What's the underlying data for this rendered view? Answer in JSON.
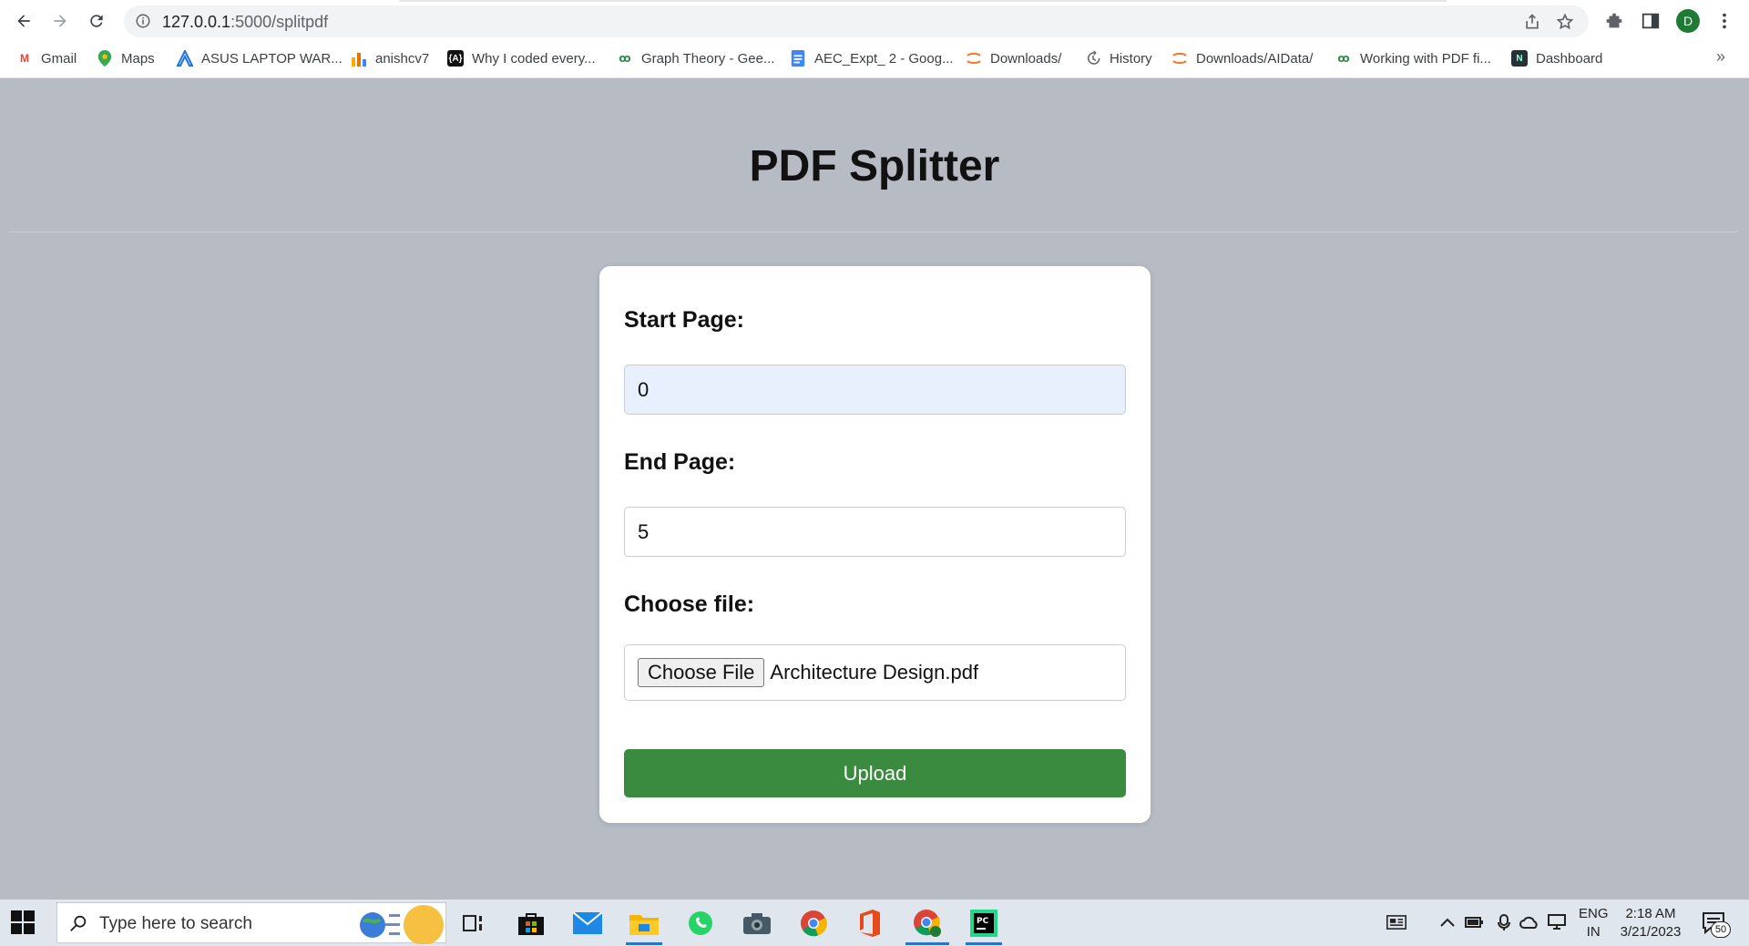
{
  "browser": {
    "url_host": "127.0.0.1",
    "url_path": ":5000/splitpdf",
    "avatar_letter": "D",
    "more_bookmarks": "»",
    "bookmarks": [
      {
        "label": "Gmail",
        "icon": "gmail-icon",
        "color": "#ea4335"
      },
      {
        "label": "Maps",
        "icon": "maps-icon",
        "color": "#34a853"
      },
      {
        "label": "ASUS LAPTOP WAR...",
        "icon": "asus-icon",
        "color": "#1a73e8"
      },
      {
        "label": "anishcv7",
        "icon": "bar-chart-icon",
        "color": "#f9ab00"
      },
      {
        "label": "Why I coded every...",
        "icon": "site-icon",
        "color": "#111111"
      },
      {
        "label": "Graph Theory - Gee...",
        "icon": "gfg-icon",
        "color": "#2f8d46"
      },
      {
        "label": "AEC_Expt_ 2 - Goog...",
        "icon": "docs-icon",
        "color": "#4285f4"
      },
      {
        "label": "Downloads/",
        "icon": "jupyter-icon",
        "color": "#f37626"
      },
      {
        "label": "History",
        "icon": "history-icon",
        "color": "#5f6368"
      },
      {
        "label": "Downloads/AIData/",
        "icon": "jupyter-icon",
        "color": "#f37626"
      },
      {
        "label": "Working with PDF fi...",
        "icon": "gfg-icon",
        "color": "#2f8d46"
      },
      {
        "label": "Dashboard",
        "icon": "dashboard-icon",
        "color": "#263238"
      }
    ]
  },
  "page": {
    "title": "PDF Splitter",
    "start_label": "Start Page:",
    "start_value": "0",
    "end_label": "End Page:",
    "end_value": "5",
    "file_label": "Choose file:",
    "file_button": "Choose File",
    "file_name": "Architecture Design.pdf",
    "upload_label": "Upload",
    "accent": "#3a8a3f"
  },
  "taskbar": {
    "search_placeholder": "Type here to search",
    "lang_top": "ENG",
    "lang_bottom": "IN",
    "time": "2:18 AM",
    "date": "3/21/2023",
    "notification_count": "50"
  }
}
